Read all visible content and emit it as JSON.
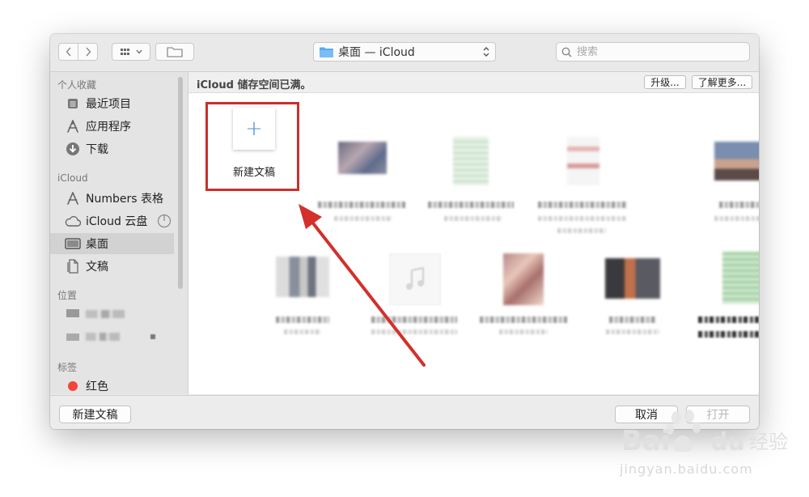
{
  "toolbar": {
    "location": "桌面 — iCloud",
    "search_placeholder": "搜索"
  },
  "sidebar": {
    "favorites_header": "个人收藏",
    "favorites": [
      "最近项目",
      "应用程序",
      "下载"
    ],
    "icloud_header": "iCloud",
    "icloud": [
      "Numbers 表格",
      "iCloud 云盘",
      "桌面",
      "文稿"
    ],
    "locations_header": "位置",
    "tags_header": "标签",
    "tags": [
      "红色"
    ],
    "selected": "桌面"
  },
  "banner": {
    "message": "iCloud 储存空间已满。",
    "upgrade_label": "升级...",
    "learn_more_label": "了解更多..."
  },
  "content": {
    "new_document_label": "新建文稿"
  },
  "footer": {
    "new_document_label": "新建文稿",
    "cancel_label": "取消",
    "open_label": "打开"
  },
  "watermark": {
    "url": "jingyan.baidu.com"
  },
  "colors": {
    "highlight_red": "#c9302c",
    "accent_blue": "#4a90d9",
    "tag_red": "#f0463c"
  }
}
